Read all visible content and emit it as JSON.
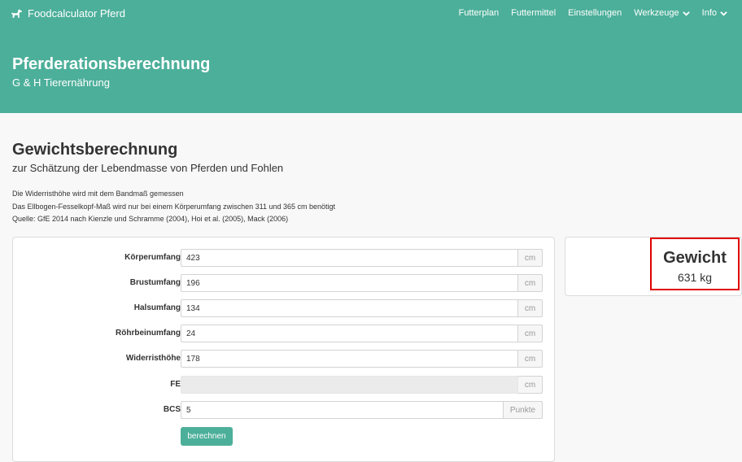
{
  "navbar": {
    "brand": "Foodcalculator Pferd",
    "items": [
      {
        "label": "Futterplan",
        "dropdown": false
      },
      {
        "label": "Futtermittel",
        "dropdown": false
      },
      {
        "label": "Einstellungen",
        "dropdown": false
      },
      {
        "label": "Werkzeuge",
        "dropdown": true
      },
      {
        "label": "Info",
        "dropdown": true
      }
    ]
  },
  "hero": {
    "title": "Pferderationsberechnung",
    "subtitle": "G & H Tierernährung"
  },
  "page": {
    "title": "Gewichtsberechnung",
    "subtitle": "zur Schätzung der Lebendmasse von Pferden und Fohlen",
    "info": [
      "Die Widerristhöhe wird mit dem Bandmaß gemessen",
      "Das Ellbogen-Fesselkopf-Maß wird nur bei einem Körperumfang zwischen 311 und 365 cm benötigt",
      "Quelle: GfE 2014 nach Kienzle und Schramme (2004), Hoi et al. (2005), Mack (2006)"
    ]
  },
  "form": {
    "fields": [
      {
        "label": "Körperumfang",
        "value": "423",
        "unit": "cm",
        "disabled": false
      },
      {
        "label": "Brustumfang",
        "value": "196",
        "unit": "cm",
        "disabled": false
      },
      {
        "label": "Halsumfang",
        "value": "134",
        "unit": "cm",
        "disabled": false
      },
      {
        "label": "Röhrbeinumfang",
        "value": "24",
        "unit": "cm",
        "disabled": false
      },
      {
        "label": "Widerristhöhe",
        "value": "178",
        "unit": "cm",
        "disabled": false
      },
      {
        "label": "FE",
        "value": "",
        "unit": "cm",
        "disabled": true
      },
      {
        "label": "BCS",
        "value": "5",
        "unit": "Punkte",
        "disabled": false
      }
    ],
    "button_label": "berechnen"
  },
  "result": {
    "label": "Gewicht",
    "value": "631 kg"
  },
  "colors": {
    "primary": "#4caf9a",
    "highlight": "#e00000"
  }
}
